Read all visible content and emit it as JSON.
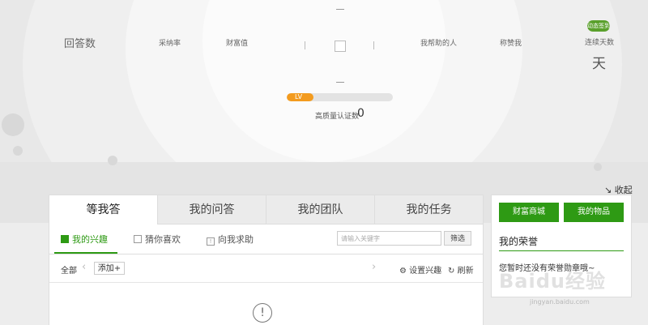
{
  "stats": {
    "answers_label": "回答数",
    "adopted_label": "采纳率",
    "wealth_label": "财富值",
    "helped_label": "我帮助的人",
    "praised_label": "称赞我",
    "days_label": "连续天数",
    "days_unit": "天",
    "badge_text": "动态签到"
  },
  "level": {
    "label": "LV",
    "progress": 0.25
  },
  "quality": {
    "label": "高质量认证数",
    "value": "0"
  },
  "collapse_label": "收起",
  "tabs": [
    "等我答",
    "我的问答",
    "我的团队",
    "我的任务"
  ],
  "subnav": {
    "interest": "我的兴趣",
    "guess": "猜你喜欢",
    "ask_me": "向我求助",
    "search_placeholder": "请输入关键字",
    "filter": "筛选"
  },
  "toolbar": {
    "all": "全部",
    "add": "添加+",
    "set_interest": "设置兴趣",
    "refresh": "刷新"
  },
  "empty_icon": "!",
  "side": {
    "mall_button": "财富商城",
    "items_button": "我的物品",
    "honor_title": "我的荣誉",
    "honor_empty": "您暂时还没有荣誉勋章哦~"
  },
  "watermark": {
    "main": "Baidu经验",
    "sub": "jingyan.baidu.com"
  },
  "colors": {
    "accent": "#2e9a14",
    "level": "#f39b1e"
  }
}
